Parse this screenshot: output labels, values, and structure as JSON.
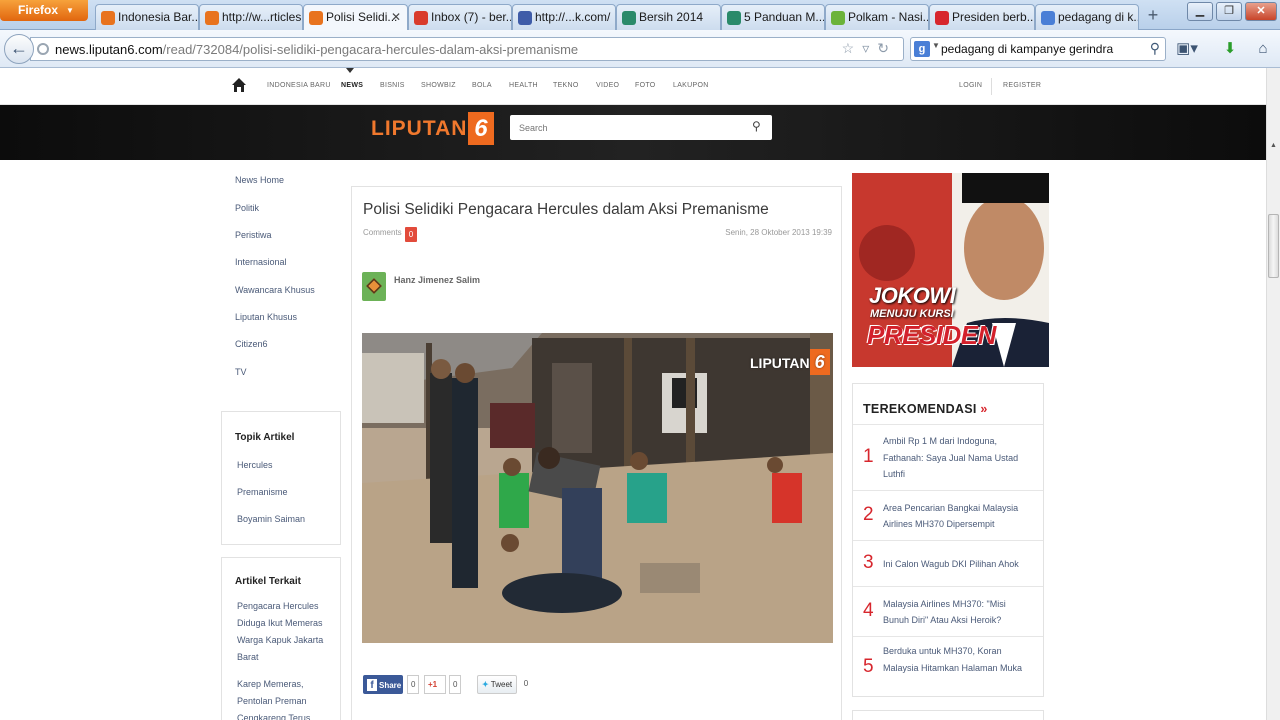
{
  "browser": {
    "menu_button": "Firefox",
    "tabs": [
      {
        "label": "Indonesia Bar...",
        "active": false,
        "favicon_color": "#e8731e"
      },
      {
        "label": "http://w...rticles",
        "active": false,
        "favicon_color": "#e8731e"
      },
      {
        "label": "Polisi Selidi...",
        "active": true,
        "favicon_color": "#e8731e"
      },
      {
        "label": "Inbox (7) - ber...",
        "active": false,
        "favicon_color": "#d93b2b"
      },
      {
        "label": "http://...k.com/",
        "active": false,
        "favicon_color": "#3f5ca8"
      },
      {
        "label": "Bersih 2014",
        "active": false,
        "favicon_color": "#2a8a6a"
      },
      {
        "label": "5 Panduan M...",
        "active": false,
        "favicon_color": "#2a8a6a"
      },
      {
        "label": "Polkam - Nasi...",
        "active": false,
        "favicon_color": "#6bb33a"
      },
      {
        "label": "Presiden berb...",
        "active": false,
        "favicon_color": "#d7262d"
      },
      {
        "label": "pedagang di k...",
        "active": false,
        "favicon_color": "#4a7fd6"
      }
    ],
    "new_tab": "+",
    "url_host": "news.liputan6.com",
    "url_path": "/read/732084/polisi-selidiki-pengacara-hercules-dalam-aksi-premanisme",
    "url_prefix": "",
    "search_query": "pedagang di kampanye gerindra",
    "search_engine_letter": "g"
  },
  "site": {
    "nav": [
      "INDONESIA BARU",
      "NEWS",
      "BISNIS",
      "SHOWBIZ",
      "BOLA",
      "HEALTH",
      "TEKNO",
      "VIDEO",
      "FOTO",
      "LAKUPON"
    ],
    "login": "LOGIN",
    "register": "REGISTER",
    "logo_text": "LIPUTAN",
    "logo_num": "6",
    "search_placeholder": "Search"
  },
  "sidebar": {
    "links": [
      "News Home",
      "Politik",
      "Peristiwa",
      "Internasional",
      "Wawancara Khusus",
      "Liputan Khusus",
      "Citizen6",
      "TV"
    ],
    "topik": {
      "title": "Topik Artikel",
      "items": [
        "Hercules",
        "Premanisme",
        "Boyamin Saiman"
      ]
    },
    "terkait": {
      "title": "Artikel Terkait",
      "items": [
        "Pengacara Hercules Diduga Ikut Memeras Warga Kapuk Jakarta Barat",
        "Karep Memeras, Pentolan Preman Cengkareng Terus"
      ]
    }
  },
  "article": {
    "title": "Polisi Selidiki Pengacara Hercules dalam Aksi Premanisme",
    "comments_label": "Comments",
    "comments_count": "0",
    "date": "Senin, 28 Oktober 2013 19:39",
    "author": "Hanz Jimenez Salim",
    "image_watermark": "LIPUTAN",
    "image_watermark_num": "6",
    "share": {
      "fb_label": "Share",
      "fb_count": "0",
      "gplus_label": "+1",
      "gplus_count": "0",
      "tweet_label": "Tweet",
      "tweet_count": "0"
    }
  },
  "ad": {
    "line1": "JOKOWI",
    "line2": "MENUJU KURSI",
    "line3": "PRESIDEN"
  },
  "recommend": {
    "title": "TEREKOMENDASI",
    "chevron": "»",
    "items": [
      {
        "num": "1",
        "text": "Ambil Rp 1 M dari Indoguna, Fathanah: Saya Jual Nama Ustad Luthfi"
      },
      {
        "num": "2",
        "text": "Area Pencarian Bangkai Malaysia Airlines MH370 Dipersempit"
      },
      {
        "num": "3",
        "text": "Ini Calon Wagub DKI Pilihan Ahok"
      },
      {
        "num": "4",
        "text": "Malaysia Airlines MH370: \"Misi Bunuh Diri\" Atau Aksi Heroik?"
      },
      {
        "num": "5",
        "text": "Berduka untuk MH370, Koran Malaysia Hitamkan Halaman Muka"
      }
    ]
  },
  "colors": {
    "brand_orange": "#ee6a1f",
    "accent_red": "#d7262d",
    "link": "#4a5a78"
  }
}
